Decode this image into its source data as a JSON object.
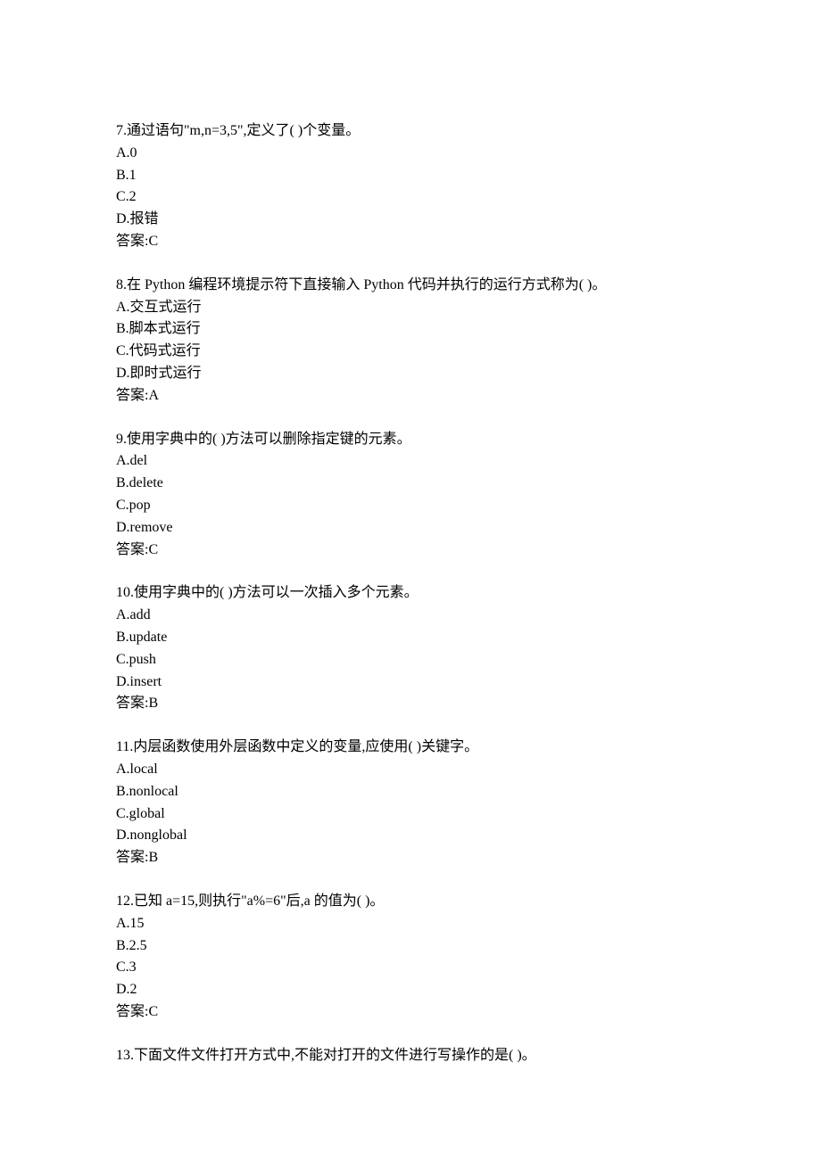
{
  "questions": [
    {
      "number": "7",
      "stem": "通过语句\"m,n=3,5\",定义了( )个变量。",
      "options": [
        "A.0",
        "B.1",
        "C.2",
        "D.报错"
      ],
      "answer": "答案:C"
    },
    {
      "number": "8",
      "stem": "在 Python 编程环境提示符下直接输入 Python 代码并执行的运行方式称为( )。",
      "options": [
        "A.交互式运行",
        "B.脚本式运行",
        "C.代码式运行",
        "D.即时式运行"
      ],
      "answer": "答案:A"
    },
    {
      "number": "9",
      "stem": "使用字典中的( )方法可以删除指定键的元素。",
      "options": [
        "A.del",
        "B.delete",
        "C.pop",
        "D.remove"
      ],
      "answer": "答案:C"
    },
    {
      "number": "10",
      "stem": "使用字典中的( )方法可以一次插入多个元素。",
      "options": [
        "A.add",
        "B.update",
        "C.push",
        "D.insert"
      ],
      "answer": "答案:B"
    },
    {
      "number": "11",
      "stem": "内层函数使用外层函数中定义的变量,应使用( )关键字。",
      "options": [
        "A.local",
        "B.nonlocal",
        "C.global",
        "D.nonglobal"
      ],
      "answer": "答案:B"
    },
    {
      "number": "12",
      "stem": "已知 a=15,则执行\"a%=6\"后,a 的值为( )。",
      "options": [
        "A.15",
        "B.2.5",
        "C.3",
        "D.2"
      ],
      "answer": "答案:C"
    },
    {
      "number": "13",
      "stem": "下面文件文件打开方式中,不能对打开的文件进行写操作的是( )。",
      "options": [],
      "answer": ""
    }
  ]
}
